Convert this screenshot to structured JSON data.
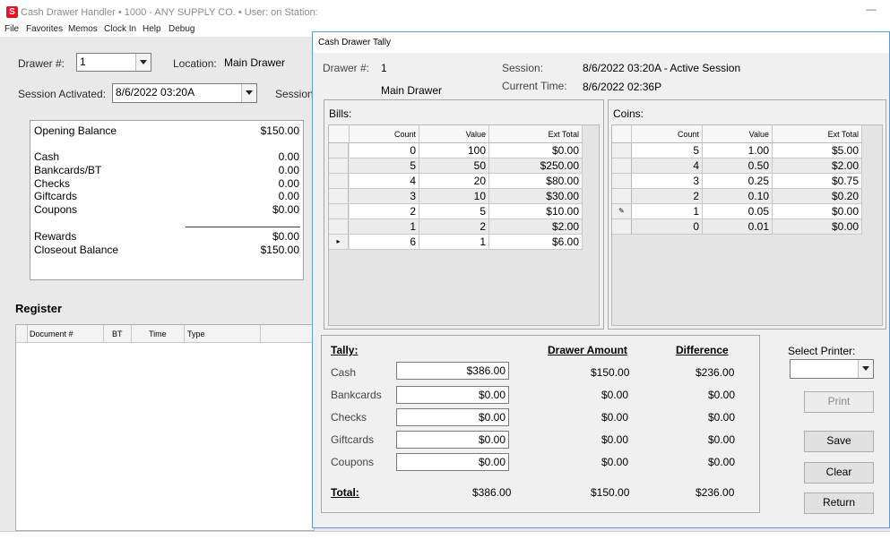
{
  "titlebar": {
    "logo": "S",
    "title": "Cash Drawer Handler  •  1000 - ANY SUPPLY CO.  •  User:             on Station:",
    "minimize": "—"
  },
  "menu": [
    "File",
    "Favorites",
    "Memos",
    "Clock In",
    "Help",
    "Debug"
  ],
  "main": {
    "drawer_label": "Drawer #:",
    "drawer_value": "1",
    "location_label": "Location:",
    "location_value": "Main Drawer",
    "session_activated_label": "Session Activated:",
    "session_activated_value": "8/6/2022 03:20A",
    "session_label": "Session",
    "summary": [
      {
        "label": "Opening Balance",
        "value": "$150.00"
      },
      {
        "label": "Cash",
        "value": "0.00"
      },
      {
        "label": "Bankcards/BT",
        "value": "0.00"
      },
      {
        "label": "Checks",
        "value": "0.00"
      },
      {
        "label": "Giftcards",
        "value": "0.00"
      },
      {
        "label": "Coupons",
        "value": "$0.00"
      },
      {
        "label": "Rewards",
        "value": "$0.00"
      },
      {
        "label": "Closeout Balance",
        "value": "$150.00"
      }
    ],
    "register_title": "Register",
    "register_columns": [
      "Document #",
      "BT",
      "Time",
      "Type"
    ]
  },
  "dialog": {
    "title": "Cash Drawer Tally",
    "drawer_label": "Drawer #:",
    "drawer_value": "1",
    "drawer_location": "Main Drawer",
    "session_label": "Session:",
    "session_value": "8/6/2022 03:20A - Active Session",
    "current_time_label": "Current Time:",
    "current_time_value": "8/6/2022 02:36P",
    "bills": {
      "title": "Bills:",
      "columns": [
        "Count",
        "Value",
        "Ext Total"
      ],
      "rows": [
        {
          "count": "0",
          "value": "100",
          "ext": "$0.00",
          "marker": ""
        },
        {
          "count": "5",
          "value": "50",
          "ext": "$250.00",
          "marker": ""
        },
        {
          "count": "4",
          "value": "20",
          "ext": "$80.00",
          "marker": ""
        },
        {
          "count": "3",
          "value": "10",
          "ext": "$30.00",
          "marker": ""
        },
        {
          "count": "2",
          "value": "5",
          "ext": "$10.00",
          "marker": ""
        },
        {
          "count": "1",
          "value": "2",
          "ext": "$2.00",
          "marker": ""
        },
        {
          "count": "6",
          "value": "1",
          "ext": "$6.00",
          "marker": "▸"
        }
      ]
    },
    "coins": {
      "title": "Coins:",
      "columns": [
        "Count",
        "Value",
        "Ext Total"
      ],
      "rows": [
        {
          "count": "5",
          "value": "1.00",
          "ext": "$5.00",
          "marker": ""
        },
        {
          "count": "4",
          "value": "0.50",
          "ext": "$2.00",
          "marker": ""
        },
        {
          "count": "3",
          "value": "0.25",
          "ext": "$0.75",
          "marker": ""
        },
        {
          "count": "2",
          "value": "0.10",
          "ext": "$0.20",
          "marker": ""
        },
        {
          "count": "1",
          "value": "0.05",
          "ext": "$0.00",
          "marker": "✎"
        },
        {
          "count": "0",
          "value": "0.01",
          "ext": "$0.00",
          "marker": ""
        }
      ]
    },
    "tally": {
      "title": "Tally:",
      "drawer_amount_header": "Drawer Amount",
      "difference_header": "Difference",
      "rows": [
        {
          "label": "Cash",
          "input": "$386.00",
          "drawer": "$150.00",
          "difference": "$236.00"
        },
        {
          "label": "Bankcards",
          "input": "$0.00",
          "drawer": "$0.00",
          "difference": "$0.00"
        },
        {
          "label": "Checks",
          "input": "$0.00",
          "drawer": "$0.00",
          "difference": "$0.00"
        },
        {
          "label": "Giftcards",
          "input": "$0.00",
          "drawer": "$0.00",
          "difference": "$0.00"
        },
        {
          "label": "Coupons",
          "input": "$0.00",
          "drawer": "$0.00",
          "difference": "$0.00"
        }
      ],
      "total_label": "Total:",
      "total_tally": "$386.00",
      "total_drawer": "$150.00",
      "total_difference": "$236.00"
    },
    "select_printer_label": "Select Printer:",
    "printer_value": "",
    "buttons": {
      "print": "Print",
      "save": "Save",
      "clear": "Clear",
      "return": "Return"
    }
  }
}
